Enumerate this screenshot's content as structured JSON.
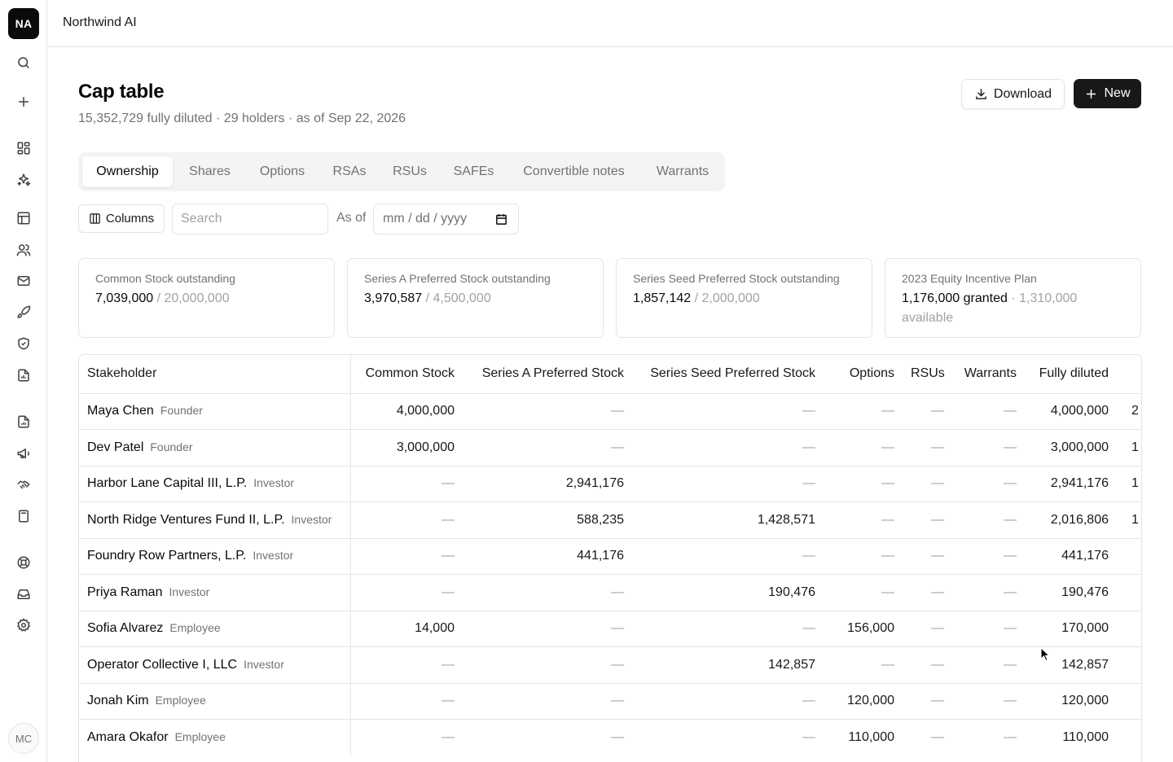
{
  "sidebar": {
    "org_initials": "NA",
    "user_initials": "MC",
    "icons": [
      "search-icon",
      "plus-icon",
      "dashboard-icon",
      "sparkles-icon",
      "table-icon",
      "users-icon",
      "mail-icon",
      "rocket-icon",
      "shield-icon",
      "report-icon",
      "document-chart-icon",
      "megaphone-icon",
      "handshake-icon",
      "calculator-icon",
      "help-icon",
      "inbox-icon",
      "settings-icon"
    ]
  },
  "topbar": {
    "company_name": "Northwind AI"
  },
  "header": {
    "title": "Cap table",
    "subtitle": "15,352,729 fully diluted · 29 holders · as of Sep 22, 2026",
    "download_label": "Download",
    "new_label": "New"
  },
  "tabs": [
    {
      "label": "Ownership",
      "active": true
    },
    {
      "label": "Shares",
      "active": false
    },
    {
      "label": "Options",
      "active": false
    },
    {
      "label": "RSAs",
      "active": false
    },
    {
      "label": "RSUs",
      "active": false
    },
    {
      "label": "SAFEs",
      "active": false
    },
    {
      "label": "Convertible notes",
      "active": false
    },
    {
      "label": "Warrants",
      "active": false
    }
  ],
  "filters": {
    "columns_label": "Columns",
    "search_placeholder": "Search",
    "as_of_label": "As of",
    "date_placeholder": "mm / dd / yyyy"
  },
  "cards": [
    {
      "title": "Common Stock outstanding",
      "value": "7,039,000",
      "sep": " / ",
      "secondary": "20,000,000",
      "trailing": ""
    },
    {
      "title": "Series A Preferred Stock outstanding",
      "value": "3,970,587",
      "sep": " / ",
      "secondary": "4,500,000",
      "trailing": ""
    },
    {
      "title": "Series Seed Preferred Stock outstanding",
      "value": "1,857,142",
      "sep": " / ",
      "secondary": "2,000,000",
      "trailing": ""
    },
    {
      "title": "2023 Equity Incentive Plan",
      "value": "1,176,000 granted",
      "sep": " · ",
      "secondary": "1,310,000",
      "trailing": "available"
    }
  ],
  "table": {
    "columns": [
      "Stakeholder",
      "Common Stock",
      "Series A Preferred Stock",
      "Series Seed Preferred Stock",
      "Options",
      "RSUs",
      "Warrants",
      "Fully diluted"
    ],
    "rows": [
      {
        "name": "Maya Chen",
        "role": "Founder",
        "cells": [
          "4,000,000",
          "—",
          "—",
          "—",
          "—",
          "—",
          "4,000,000"
        ],
        "clip": "2"
      },
      {
        "name": "Dev Patel",
        "role": "Founder",
        "cells": [
          "3,000,000",
          "—",
          "—",
          "—",
          "—",
          "—",
          "3,000,000"
        ],
        "clip": "1"
      },
      {
        "name": "Harbor Lane Capital III, L.P.",
        "role": "Investor",
        "cells": [
          "—",
          "2,941,176",
          "—",
          "—",
          "—",
          "—",
          "2,941,176"
        ],
        "clip": "1"
      },
      {
        "name": "North Ridge Ventures Fund II, L.P.",
        "role": "Investor",
        "cells": [
          "—",
          "588,235",
          "1,428,571",
          "—",
          "—",
          "—",
          "2,016,806"
        ],
        "clip": "1"
      },
      {
        "name": "Foundry Row Partners, L.P.",
        "role": "Investor",
        "cells": [
          "—",
          "441,176",
          "—",
          "—",
          "—",
          "—",
          "441,176"
        ],
        "clip": ""
      },
      {
        "name": "Priya Raman",
        "role": "Investor",
        "cells": [
          "—",
          "—",
          "190,476",
          "—",
          "—",
          "—",
          "190,476"
        ],
        "clip": ""
      },
      {
        "name": "Sofia Alvarez",
        "role": "Employee",
        "cells": [
          "14,000",
          "—",
          "—",
          "156,000",
          "—",
          "—",
          "170,000"
        ],
        "clip": ""
      },
      {
        "name": "Operator Collective I, LLC",
        "role": "Investor",
        "cells": [
          "—",
          "—",
          "142,857",
          "—",
          "—",
          "—",
          "142,857"
        ],
        "clip": ""
      },
      {
        "name": "Jonah Kim",
        "role": "Employee",
        "cells": [
          "—",
          "—",
          "—",
          "120,000",
          "—",
          "—",
          "120,000"
        ],
        "clip": ""
      },
      {
        "name": "Amara Okafor",
        "role": "Employee",
        "cells": [
          "—",
          "—",
          "—",
          "110,000",
          "—",
          "—",
          "110,000"
        ],
        "clip": ""
      }
    ]
  }
}
